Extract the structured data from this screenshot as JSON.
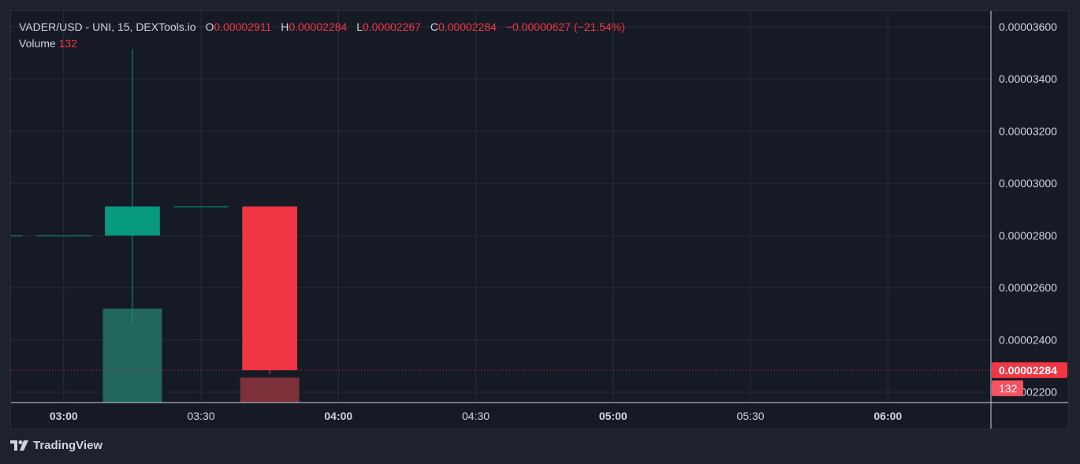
{
  "legend": {
    "symbol": "VADER/USD - UNI, 15, DEXTools.io",
    "open_label": "O",
    "open": "0.00002911",
    "high_label": "H",
    "high": "0.00002284",
    "low_label": "L",
    "low": "0.00002267",
    "close_label": "C",
    "close": "0.00002284",
    "change": "−0.00000627 (−21.54%)",
    "volume_label": "Volume",
    "volume": "132"
  },
  "price_badge": "0.00002284",
  "volume_badge": "132",
  "branding": {
    "name": "TradingView",
    "icon": "tradingview-logo-icon"
  },
  "colors": {
    "background": "#161a25",
    "page": "#1e222d",
    "grid": "#2a2e39",
    "up": "#089981",
    "down": "#f23645",
    "up_volume": "#22665c",
    "down_volume": "#7c3039",
    "text": "#d1d4dc"
  },
  "chart_data": {
    "type": "candlestick",
    "x_ticks": [
      {
        "t": 0,
        "label": "03:00",
        "bold": true
      },
      {
        "t": 30,
        "label": "03:30",
        "bold": false
      },
      {
        "t": 60,
        "label": "04:00",
        "bold": true
      },
      {
        "t": 90,
        "label": "04:30",
        "bold": false
      },
      {
        "t": 120,
        "label": "05:00",
        "bold": true
      },
      {
        "t": 150,
        "label": "05:30",
        "bold": false
      },
      {
        "t": 180,
        "label": "06:00",
        "bold": true
      }
    ],
    "y_ticks": [
      "0.00002200",
      "0.00002400",
      "0.00002600",
      "0.00002800",
      "0.00003000",
      "0.00003200",
      "0.00003400",
      "0.00003600"
    ],
    "ylim": [
      2.16e-05,
      3.66e-05
    ],
    "x_range_minutes": [
      -11.5,
      202.5
    ],
    "candles": [
      {
        "t": -15,
        "open": 2.8e-05,
        "high": 2.8e-05,
        "low": 2.8e-05,
        "close": 2.8e-05
      },
      {
        "t": 0,
        "open": 2.8e-05,
        "high": 2.8e-05,
        "low": 2.8e-05,
        "close": 2.8e-05
      },
      {
        "t": 15,
        "open": 2.8e-05,
        "high": 3.515e-05,
        "low": 2.465e-05,
        "close": 2.911e-05
      },
      {
        "t": 30,
        "open": 2.911e-05,
        "high": 2.911e-05,
        "low": 2.911e-05,
        "close": 2.911e-05
      },
      {
        "t": 45,
        "open": 2.911e-05,
        "high": 2.911e-05,
        "low": 2.267e-05,
        "close": 2.284e-05
      }
    ],
    "volume": {
      "max": 260,
      "bars": [
        {
          "t": 15,
          "value": 248,
          "direction": "up"
        },
        {
          "t": 45,
          "value": 66,
          "direction": "down"
        }
      ]
    },
    "last_price": 2.284e-05,
    "grid": true
  }
}
